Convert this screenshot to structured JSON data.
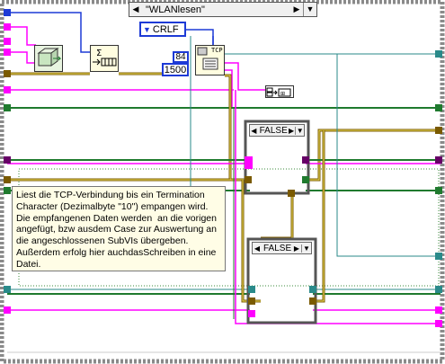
{
  "case_structure": {
    "selector_label": "\"WLANlesen\"",
    "prev_arrow": "◀",
    "next_arrow": "▶",
    "dropdown": "▼"
  },
  "constants": {
    "crlf": "CRLF",
    "bytes": "84",
    "timeout": "1500"
  },
  "tcp_read": {
    "label": "TCP"
  },
  "inner_case_1": {
    "selector_label": "FALSE",
    "prev_arrow": "◀",
    "next_arrow": "▶",
    "dropdown": "▼"
  },
  "inner_case_2": {
    "selector_label": "FALSE",
    "prev_arrow": "◀",
    "next_arrow": "▶",
    "dropdown": "▼"
  },
  "comment": {
    "text": "Liest die TCP-Verbindung bis ein Termination\nCharacter (Dezimalbyte \"10\") empangen wird.\nDie empfangenen Daten werden  an die vorigen\nangefügt, bzw ausdem Case zur Auswertung an\ndie angeschlossenen SubVIs übergeben.\nAußerdem erfolg hier auchdasSchreiben in eine\nDatei."
  },
  "colors": {
    "frame": "#808080",
    "wire_string": "#ff00ff",
    "wire_bool": "#1f7a2e",
    "wire_cluster": "#7a5a00",
    "wire_numeric": "#1d3ad6",
    "wire_teal": "#2a8a8a",
    "wire_refnum": "#8e8a00"
  }
}
